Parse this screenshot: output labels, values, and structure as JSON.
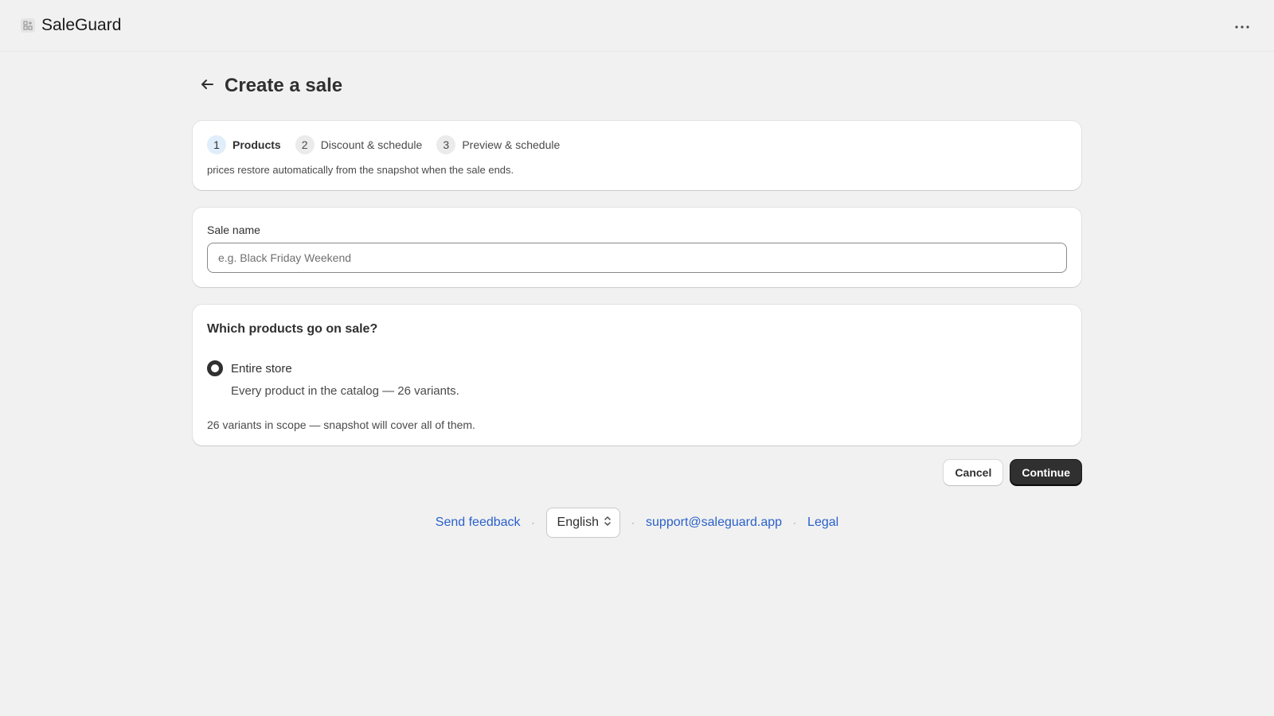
{
  "app": {
    "title": "SaleGuard"
  },
  "page": {
    "title": "Create a sale"
  },
  "steps": [
    {
      "num": "1",
      "label": "Products",
      "active": true
    },
    {
      "num": "2",
      "label": "Discount & schedule",
      "active": false
    },
    {
      "num": "3",
      "label": "Preview & schedule",
      "active": false
    }
  ],
  "steps_note": "prices restore automatically from the snapshot when the sale ends.",
  "sale_name": {
    "label": "Sale name",
    "value": "",
    "placeholder": "e.g. Black Friday Weekend"
  },
  "products": {
    "title": "Which products go on sale?",
    "option_label": "Entire store",
    "option_help": "Every product in the catalog — 26 variants.",
    "scope_note": "26 variants in scope — snapshot will cover all of them."
  },
  "actions": {
    "cancel": "Cancel",
    "continue": "Continue"
  },
  "footer": {
    "feedback": "Send feedback",
    "language": "English",
    "email": "support@saleguard.app",
    "legal": "Legal",
    "separator": "·"
  },
  "icons": {
    "app": "app-grid-icon",
    "more": "more-horizontal-icon",
    "back": "arrow-left-icon",
    "language": "chevron-up-down-icon"
  }
}
